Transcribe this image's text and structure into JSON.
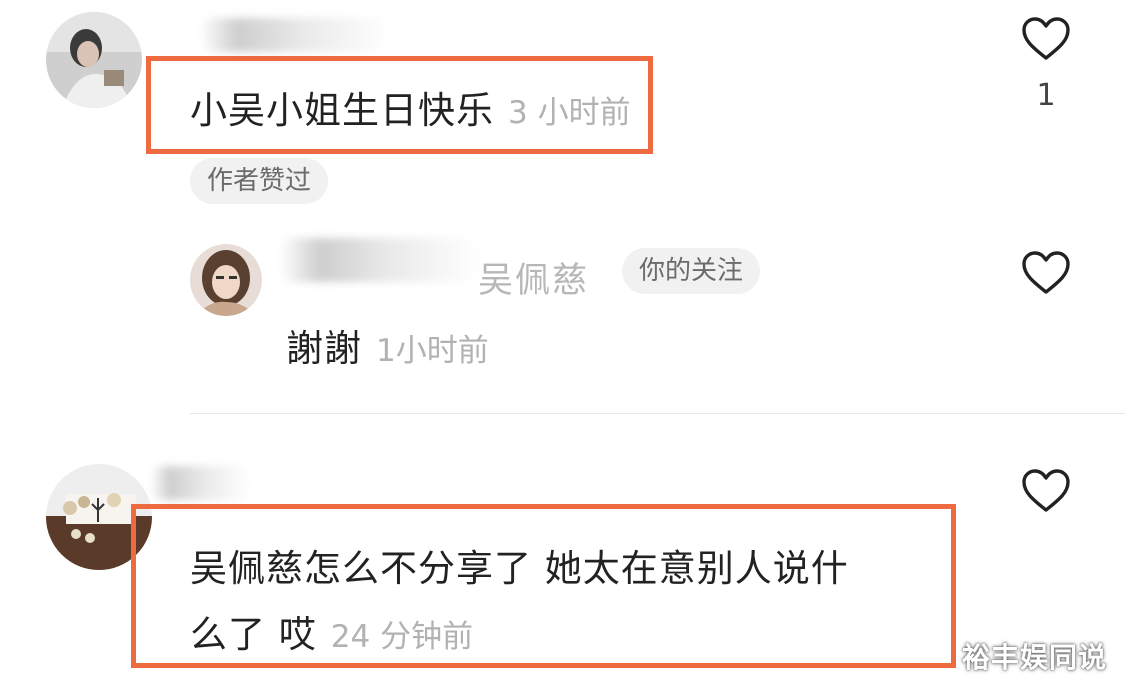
{
  "comments": [
    {
      "text": "小吴小姐生日快乐",
      "time": "3 小时前",
      "tag": "作者赞过",
      "likes": "1",
      "reply": {
        "author": "吴佩慈",
        "author_tag": "你的关注",
        "text": "謝謝",
        "time": "1小时前"
      }
    },
    {
      "text_line1": "吴佩慈怎么不分享了 她太在意别人说什",
      "text_line2": "么了 哎",
      "time": "24 分钟前"
    }
  ],
  "watermark": "裕丰娱同说",
  "colors": {
    "highlight_border": "#ee6a3f",
    "time_text": "#b2b2b2",
    "tag_bg": "#f1f1f1"
  },
  "icons": [
    "heart-outline-icon"
  ]
}
